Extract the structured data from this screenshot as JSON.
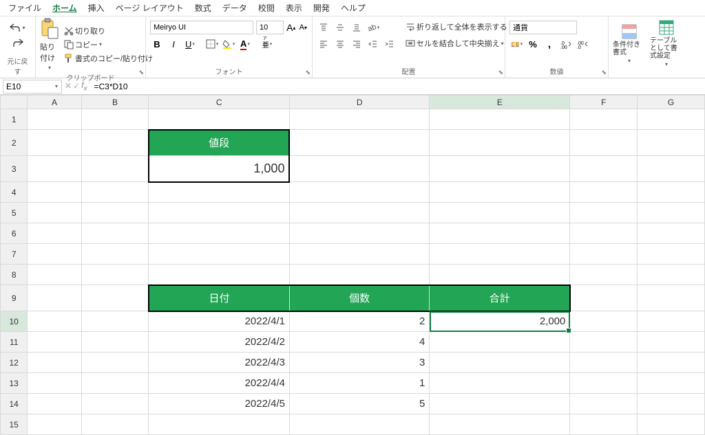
{
  "menu": {
    "file": "ファイル",
    "home": "ホーム",
    "insert": "挿入",
    "pagelayout": "ページ レイアウト",
    "formulas": "数式",
    "data": "データ",
    "review": "校閲",
    "view": "表示",
    "dev": "開発",
    "help": "ヘルプ"
  },
  "ribbon": {
    "undoGroup": "元に戻す",
    "clipboardGroup": "クリップボード",
    "paste": "貼り付け",
    "cut": "切り取り",
    "copy": "コピー",
    "formatPainter": "書式のコピー/貼り付け",
    "fontGroup": "フォント",
    "fontName": "Meiryo UI",
    "fontSize": "10",
    "alignGroup": "配置",
    "wrap": "折り返して全体を表示する",
    "merge": "セルを結合して中央揃え",
    "numberGroup": "数値",
    "numberFormat": "通貨",
    "condFormat": "条件付き書式",
    "tableFormat": "テーブルとして書式設定"
  },
  "fbar": {
    "cellRef": "E10",
    "formula": "=C3*D10"
  },
  "cols": [
    "A",
    "B",
    "C",
    "D",
    "E",
    "F",
    "G"
  ],
  "sheet": {
    "c2": "値段",
    "c3": "1,000",
    "c9": "日付",
    "d9": "個数",
    "e9": "合計",
    "c10": "2022/4/1",
    "d10": "2",
    "e10": "2,000",
    "c11": "2022/4/2",
    "d11": "4",
    "c12": "2022/4/3",
    "d12": "3",
    "c13": "2022/4/4",
    "d13": "1",
    "c14": "2022/4/5",
    "d14": "5"
  }
}
